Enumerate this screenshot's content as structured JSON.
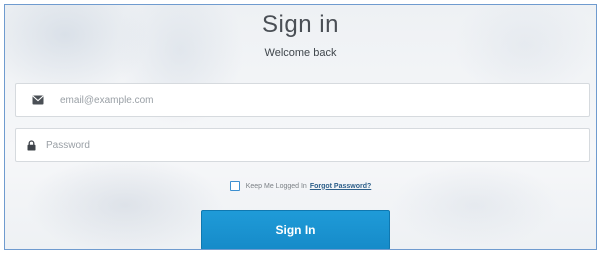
{
  "header": {
    "title": "Sign in",
    "subtitle": "Welcome back"
  },
  "form": {
    "email": {
      "icon": "envelope-icon",
      "placeholder": "email@example.com",
      "value": ""
    },
    "password": {
      "icon": "lock-icon",
      "placeholder": "Password",
      "value": ""
    },
    "remember": {
      "label": "Keep Me Logged In",
      "checked": false
    },
    "forgot_link": "Forgot Password?",
    "submit_label": "Sign In"
  },
  "colors": {
    "accent": "#1a93d2",
    "border": "#6f9bcf",
    "link": "#2d5f8a"
  }
}
